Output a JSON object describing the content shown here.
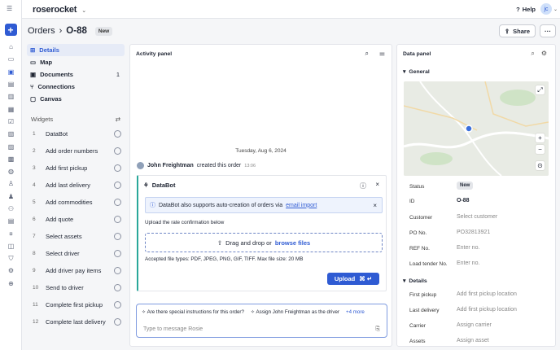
{
  "topbar": {
    "brand": "roserocket",
    "help_label": "Help",
    "avatar_initial": "jc"
  },
  "header": {
    "section": "Orders",
    "separator": "›",
    "order_id": "O-88",
    "status_badge": "New",
    "share_label": "Share"
  },
  "nav": [
    {
      "label": "Details",
      "icon": "grid-icon",
      "active": true
    },
    {
      "label": "Map",
      "icon": "map-icon"
    },
    {
      "label": "Documents",
      "icon": "document-icon",
      "count": "1"
    },
    {
      "label": "Connections",
      "icon": "connections-icon"
    },
    {
      "label": "Canvas",
      "icon": "canvas-icon"
    }
  ],
  "widgets": {
    "title": "Widgets",
    "items": [
      {
        "num": "1",
        "label": "DataBot"
      },
      {
        "num": "2",
        "label": "Add order numbers"
      },
      {
        "num": "3",
        "label": "Add first pickup"
      },
      {
        "num": "4",
        "label": "Add last delivery"
      },
      {
        "num": "5",
        "label": "Add commodities"
      },
      {
        "num": "6",
        "label": "Add quote"
      },
      {
        "num": "7",
        "label": "Select assets"
      },
      {
        "num": "8",
        "label": "Select driver"
      },
      {
        "num": "9",
        "label": "Add driver pay items"
      },
      {
        "num": "10",
        "label": "Send to driver"
      },
      {
        "num": "11",
        "label": "Complete first pickup"
      },
      {
        "num": "12",
        "label": "Complete last delivery"
      }
    ]
  },
  "activity": {
    "title": "Activity panel",
    "date": "Tuesday, Aug 6, 2024",
    "event_user": "John Freightman",
    "event_text": "created this order",
    "event_time": "13:06",
    "databot": {
      "title": "DataBot",
      "info_text": "DataBot also supports auto-creation of orders via",
      "info_link": "email import",
      "upload_label": "Upload the rate confirmation below",
      "drop_text": "Drag and drop or",
      "drop_link": "browse files",
      "accepted": "Accepted file types: PDF, JPEG, PNG, GIF, TIFF. Max file size: 20 MB",
      "upload_button": "Upload"
    },
    "chat": {
      "suggestion_1": "Are there special instructions for this order?",
      "suggestion_2": "Assign John Freightman as the driver",
      "more": "+4 more",
      "placeholder": "Type to message Rosie"
    }
  },
  "datapanel": {
    "title": "Data panel",
    "general_title": "General",
    "details_title": "Details",
    "fields": [
      {
        "label": "Status",
        "value": "New"
      },
      {
        "label": "ID",
        "value": "O-88"
      },
      {
        "label": "Customer",
        "value": "Select customer"
      },
      {
        "label": "PO No.",
        "value": "PO32813921"
      },
      {
        "label": "REF No.",
        "value": "Enter no."
      },
      {
        "label": "Load tender No.",
        "value": "Enter no."
      }
    ],
    "details": [
      {
        "label": "First pickup",
        "value": "Add first pickup location"
      },
      {
        "label": "Last delivery",
        "value": "Add first pickup location"
      },
      {
        "label": "Carrier",
        "value": "Assign carrier"
      },
      {
        "label": "Assets",
        "value": "Assign asset"
      }
    ]
  },
  "colors": {
    "accent": "#2f5bd3",
    "databot_accent": "#2aa89a"
  }
}
